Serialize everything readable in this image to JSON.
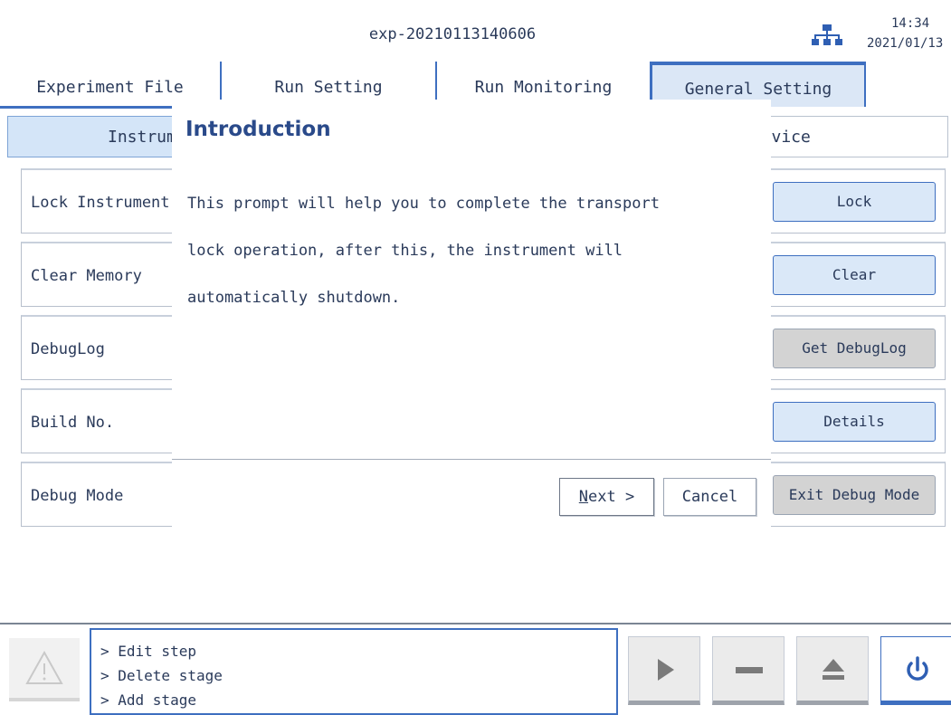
{
  "header": {
    "title": "exp-20210113140606",
    "time": "14:34",
    "date": "2021/01/13",
    "network_icon": "network-icon"
  },
  "tabs": [
    {
      "label": "Experiment File"
    },
    {
      "label": "Run Setting"
    },
    {
      "label": "Run Monitoring"
    },
    {
      "label": "General Setting",
      "active": true
    }
  ],
  "subtabs": {
    "left_label": "Instrument",
    "right_label": "Service"
  },
  "rows": [
    {
      "label": "Lock Instrument",
      "button": "Lock"
    },
    {
      "label": "Clear Memory",
      "button": "Clear"
    },
    {
      "label": "DebugLog",
      "button": "Get DebugLog"
    },
    {
      "label": "Build No.",
      "button": "Details"
    },
    {
      "label": "Debug Mode",
      "button": "Exit Debug Mode"
    }
  ],
  "dialog": {
    "title": "Introduction",
    "body_lines": [
      "This prompt will help you to complete the transport",
      "lock operation, after this, the instrument will",
      "automatically shutdown."
    ],
    "next_label": "Next >",
    "cancel_label": "Cancel"
  },
  "log": {
    "lines": [
      "> Edit step",
      "> Delete stage",
      "> Add stage"
    ]
  },
  "controls": {
    "warning_icon": "warning-icon",
    "play_icon": "play-icon",
    "stop_icon": "stop-icon",
    "eject_icon": "eject-icon",
    "power_icon": "power-icon"
  },
  "colors": {
    "accent": "#3e6fc0",
    "active_tab": "#dbe7f6",
    "button_blue": "#dae8f8",
    "button_gray": "#d3d3d3",
    "dialog_title": "#2a4a8a"
  }
}
